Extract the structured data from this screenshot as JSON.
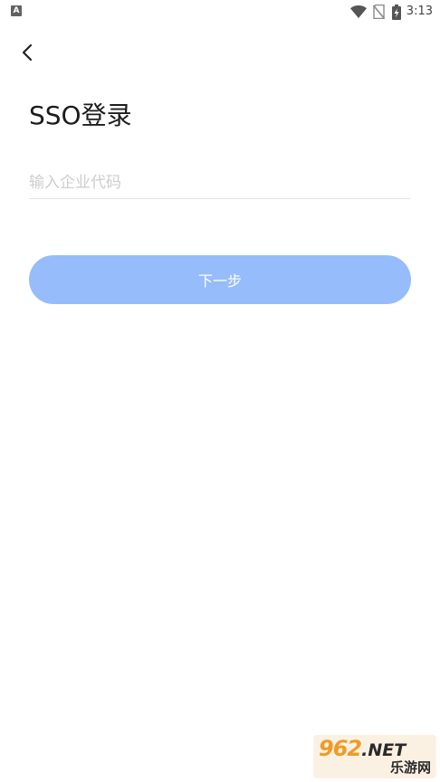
{
  "status_bar": {
    "notification_icon_text": "A",
    "time": "3:13"
  },
  "header": {
    "title": "SSO登录"
  },
  "form": {
    "company_code_placeholder": "输入企业代码",
    "company_code_value": "",
    "next_button_label": "下一步"
  },
  "watermark": {
    "top_text": "962",
    "net_text": ".NET",
    "bottom_text": "乐游网"
  },
  "colors": {
    "primary_button": "#96bcfb",
    "title_text": "#1c1c1c",
    "placeholder_text": "#cdcdcd",
    "divider": "#e3e3e3"
  },
  "icons": {
    "back": "chevron-left-icon",
    "wifi": "wifi-icon",
    "sim": "no-sim-icon",
    "battery": "battery-charging-icon"
  }
}
